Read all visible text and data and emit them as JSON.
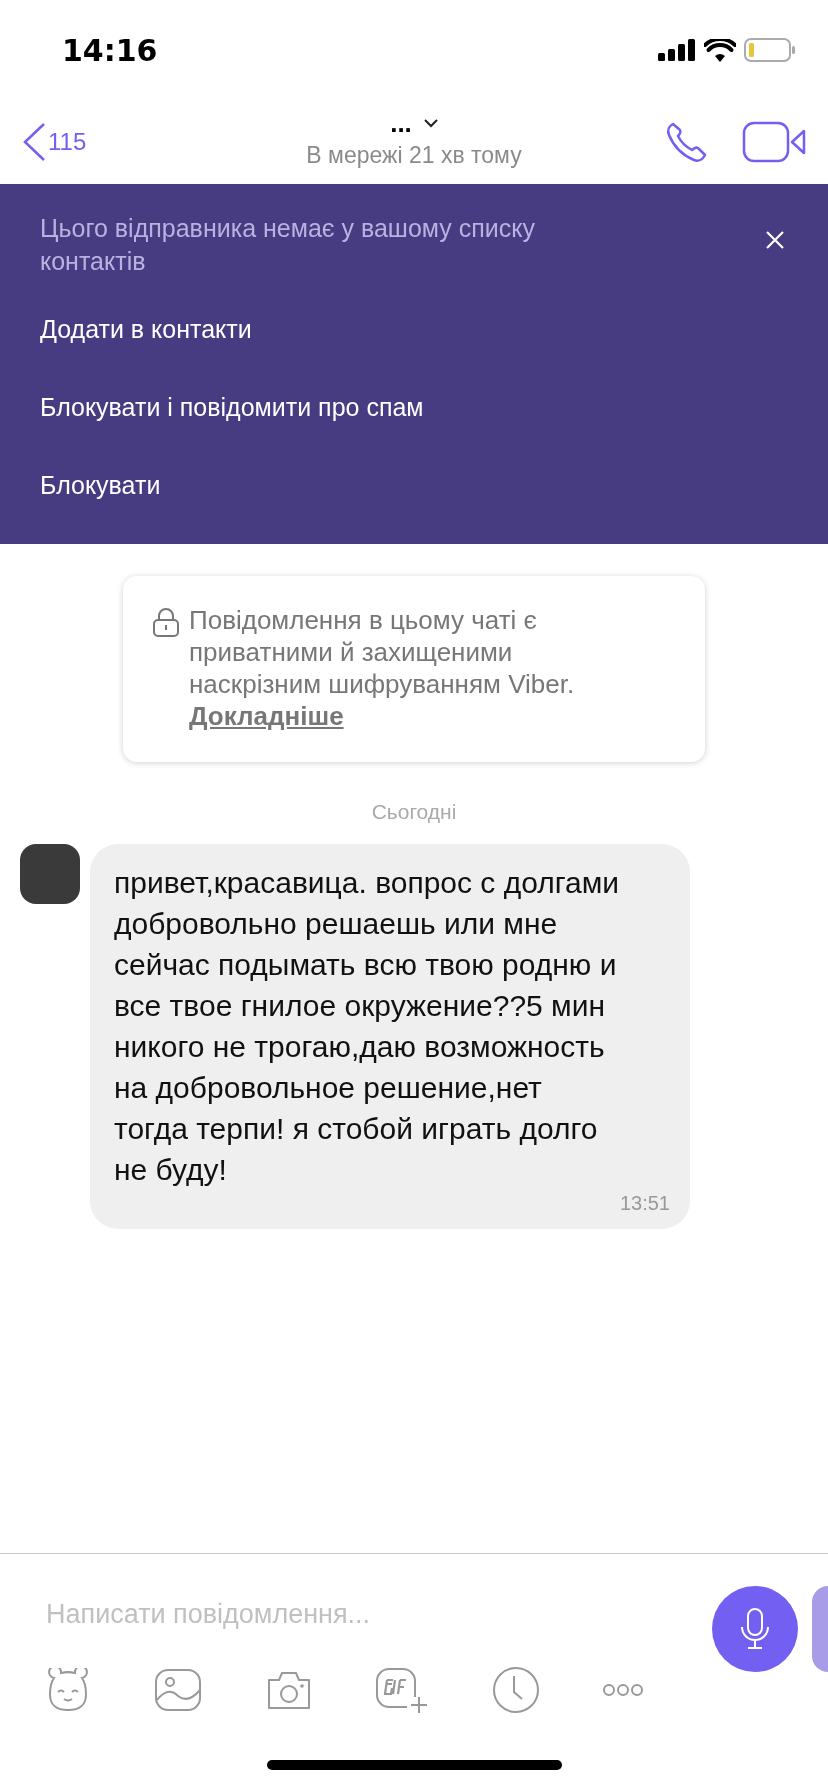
{
  "status_bar": {
    "time": "14:16"
  },
  "header": {
    "back_count": "115",
    "title": "...",
    "subtitle": "В мережі 21 хв тому"
  },
  "unknown_sender_banner": {
    "message": "Цього відправника немає у вашому списку контактів",
    "actions": [
      "Додати в контакти",
      "Блокувати і повідомити про спам",
      "Блокувати"
    ]
  },
  "encryption_notice": {
    "text": "Повідомлення в цьому чаті є приватними й захищеними наскрізним шифруванням Viber.",
    "link": "Докладніше"
  },
  "date_separator": "Сьогодні",
  "messages": [
    {
      "text": "привет,красавица. вопрос с долгами добровольно решаешь или мне сейчас подымать всю твою родню и все твое гнилое окружение??5 мин никого не трогаю,даю возможность на добровольное решение,нет тогда терпи! я стобой играть долго не буду!",
      "time": "13:51"
    }
  ],
  "composer": {
    "placeholder": "Написати повідомлення..."
  }
}
